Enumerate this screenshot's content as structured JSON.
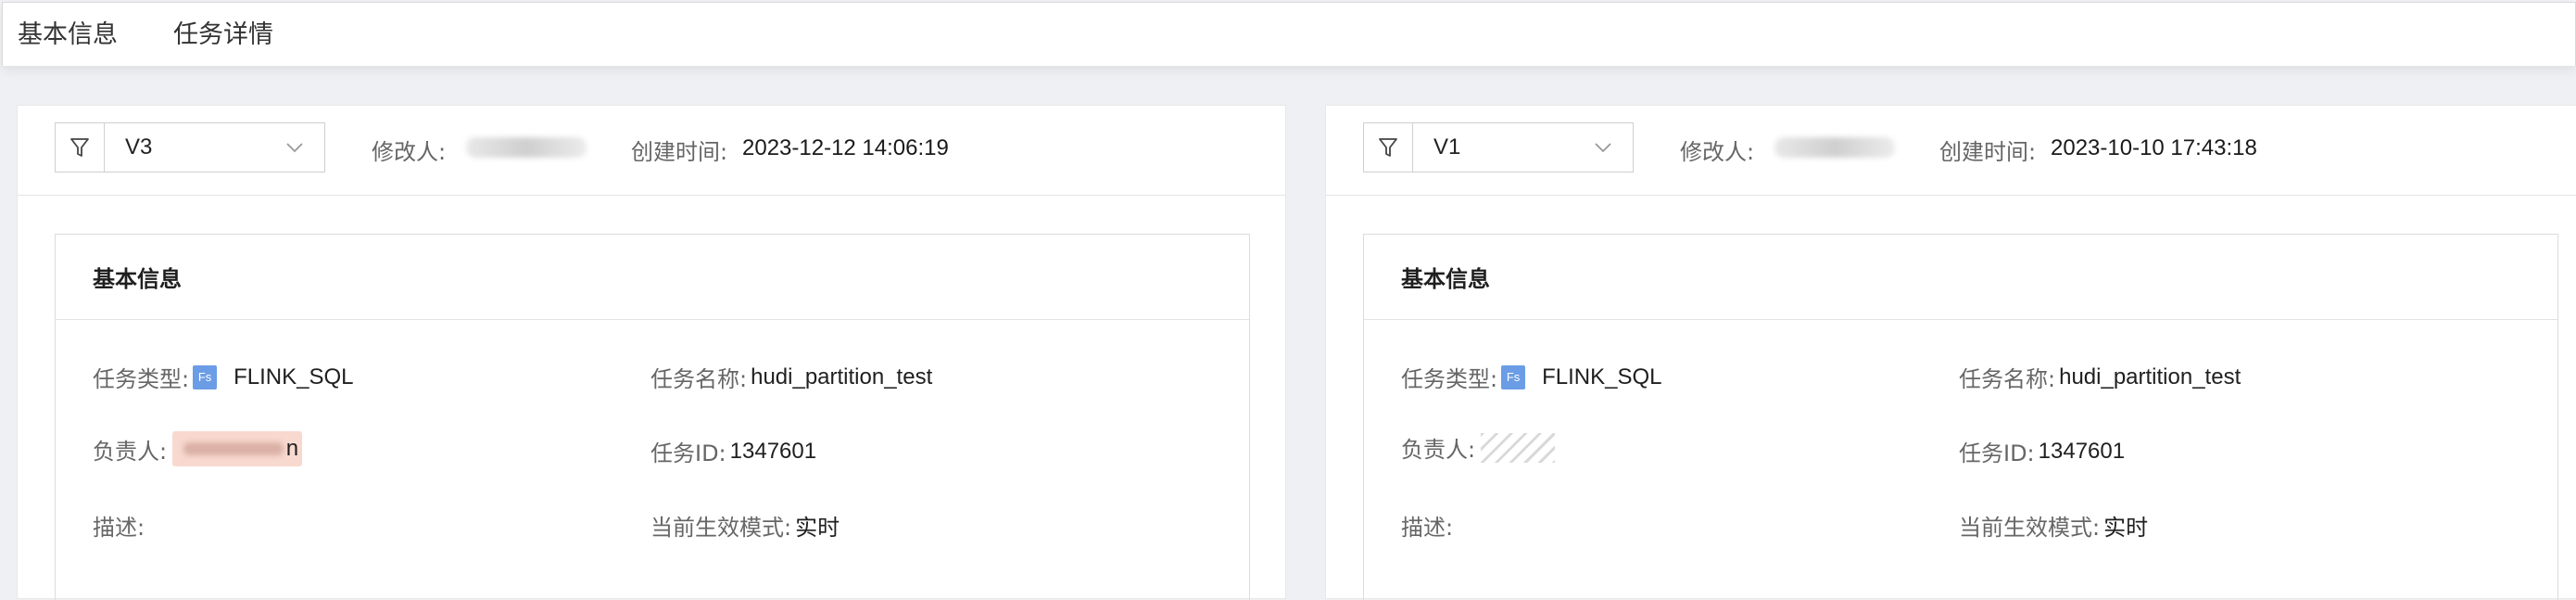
{
  "tabs": [
    "基本信息",
    "任务详情"
  ],
  "left": {
    "version": "V3",
    "modifier_label": "修改人:",
    "created_label": "创建时间:",
    "created_value": "2023-12-12 14:06:19",
    "section_title": "基本信息",
    "task_type_label": "任务类型:",
    "task_type_badge": "Fs",
    "task_type_value": "FLINK_SQL",
    "task_name_label": "任务名称:",
    "task_name_value": "hudi_partition_test",
    "owner_label": "负责人:",
    "owner_tail": "n",
    "task_id_label": "任务ID:",
    "task_id_value": "1347601",
    "desc_label": "描述:",
    "mode_label": "当前生效模式:",
    "mode_value": "实时"
  },
  "right": {
    "version": "V1",
    "modifier_label": "修改人:",
    "created_label": "创建时间:",
    "created_value": "2023-10-10 17:43:18",
    "section_title": "基本信息",
    "task_type_label": "任务类型:",
    "task_type_badge": "Fs",
    "task_type_value": "FLINK_SQL",
    "task_name_label": "任务名称:",
    "task_name_value": "hudi_partition_test",
    "owner_label": "负责人:",
    "task_id_label": "任务ID:",
    "task_id_value": "1347601",
    "desc_label": "描述:",
    "mode_label": "当前生效模式:",
    "mode_value": "实时"
  },
  "colors": {
    "badge": "#6b9de6",
    "owner_highlight": "#f8d9cf"
  }
}
